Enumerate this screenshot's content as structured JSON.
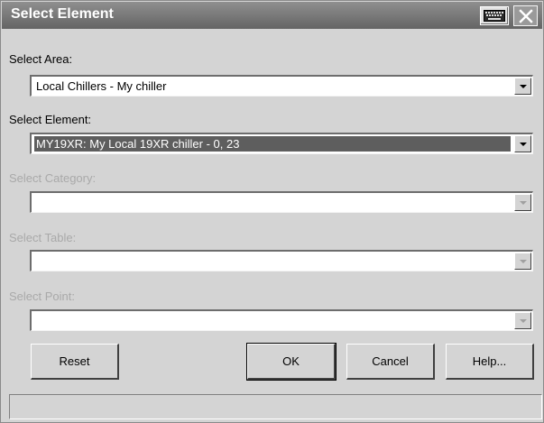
{
  "window": {
    "title": "Select Element"
  },
  "fields": {
    "area": {
      "label": "Select Area:",
      "value": "Local Chillers - My chiller"
    },
    "element": {
      "label": "Select Element:",
      "value": "MY19XR: My Local 19XR chiller - 0, 23"
    },
    "category": {
      "label": "Select Category:",
      "value": ""
    },
    "table": {
      "label": "Select Table:",
      "value": ""
    },
    "point": {
      "label": "Select Point:",
      "value": ""
    }
  },
  "buttons": {
    "reset": "Reset",
    "ok": "OK",
    "cancel": "Cancel",
    "help": "Help..."
  },
  "status": {
    "text": ""
  },
  "colors": {
    "titlebar": "#646464",
    "highlight": "#5e5e5e",
    "disabled_text": "#a9a9a9"
  },
  "icons": {
    "keyboard": "keyboard-icon",
    "close": "close-icon",
    "dropdown": "chevron-down-icon"
  }
}
